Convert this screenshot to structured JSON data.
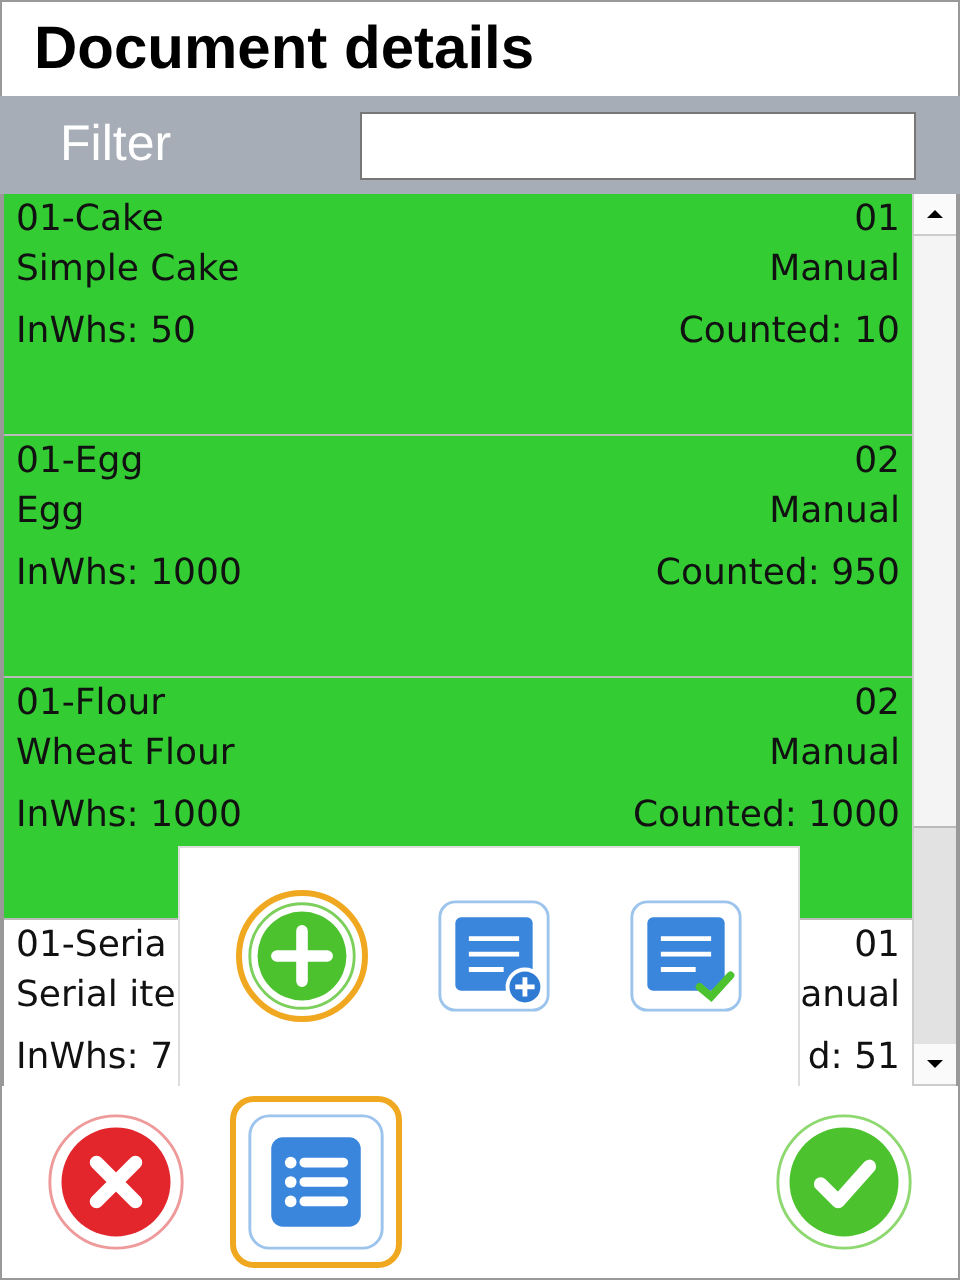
{
  "title": "Document details",
  "filter": {
    "label": "Filter"
  },
  "rows": [
    {
      "code": "01-Cake",
      "number": "01",
      "name": "Simple Cake",
      "mode": "Manual",
      "in_whs": "InWhs: 50",
      "counted": "Counted: 10",
      "selected": true
    },
    {
      "code": "01-Egg",
      "number": "02",
      "name": "Egg",
      "mode": "Manual",
      "in_whs": "InWhs: 1000",
      "counted": "Counted: 950",
      "selected": true
    },
    {
      "code": "01-Flour",
      "number": "02",
      "name": "Wheat Flour",
      "mode": "Manual",
      "in_whs": "InWhs: 1000",
      "counted": "Counted: 1000",
      "selected": true
    },
    {
      "code": "01-Seria",
      "number": "01",
      "name": "Serial ite",
      "mode": "anual",
      "in_whs": "InWhs: 7",
      "counted": "d: 51",
      "selected": false
    }
  ],
  "popup_menu": [
    {
      "kind": "add",
      "focused": true
    },
    {
      "kind": "add-document",
      "focused": false
    },
    {
      "kind": "check-document",
      "focused": false
    }
  ],
  "bottom_buttons": [
    {
      "kind": "cancel",
      "focused": false
    },
    {
      "kind": "list",
      "focused": true
    },
    {
      "kind": "confirm",
      "focused": false
    }
  ]
}
